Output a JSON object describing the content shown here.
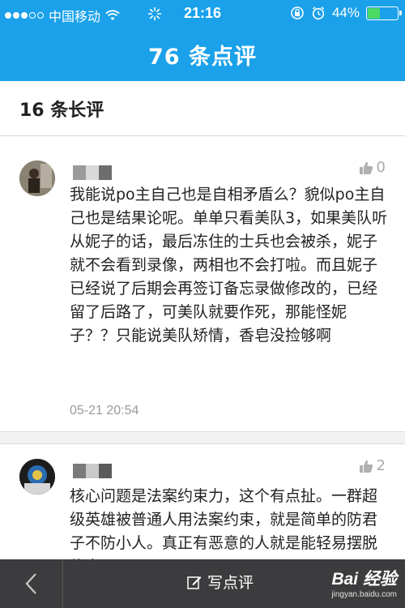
{
  "status_bar": {
    "carrier": "中国移动",
    "time": "21:16",
    "battery_text": "44%",
    "battery_level": 0.44
  },
  "nav": {
    "title": "76 条点评"
  },
  "section": {
    "title": "16 条长评"
  },
  "reviews": [
    {
      "likes": "0",
      "text": "我能说po主自己也是自相矛盾么？貌似po主自己也是结果论呢。单单只看美队3，如果美队听从妮子的话，最后冻住的士兵也会被杀，妮子就不会看到录像，两相也不会打啦。而且妮子已经说了后期会再签订备忘录做修改的，已经留了后路了，可美队就要作死，那能怪妮子？？只能说美队矫情，香皂没捡够啊",
      "date": "05-21 20:54"
    },
    {
      "likes": "2",
      "text": "核心问题是法案约束力，这个有点扯。一群超级英雄被普通人用法案约束，就是简单的防君子不防小人。真正有恶意的人就是能轻易摆脱约束"
    }
  ],
  "bottom_bar": {
    "write_label": "写点评",
    "watermark_logo": "Bai 经验",
    "watermark_url": "jingyan.baidu.com"
  },
  "colors": {
    "accent": "#1aa1ea",
    "bottom_bar": "#3c3c3e"
  }
}
